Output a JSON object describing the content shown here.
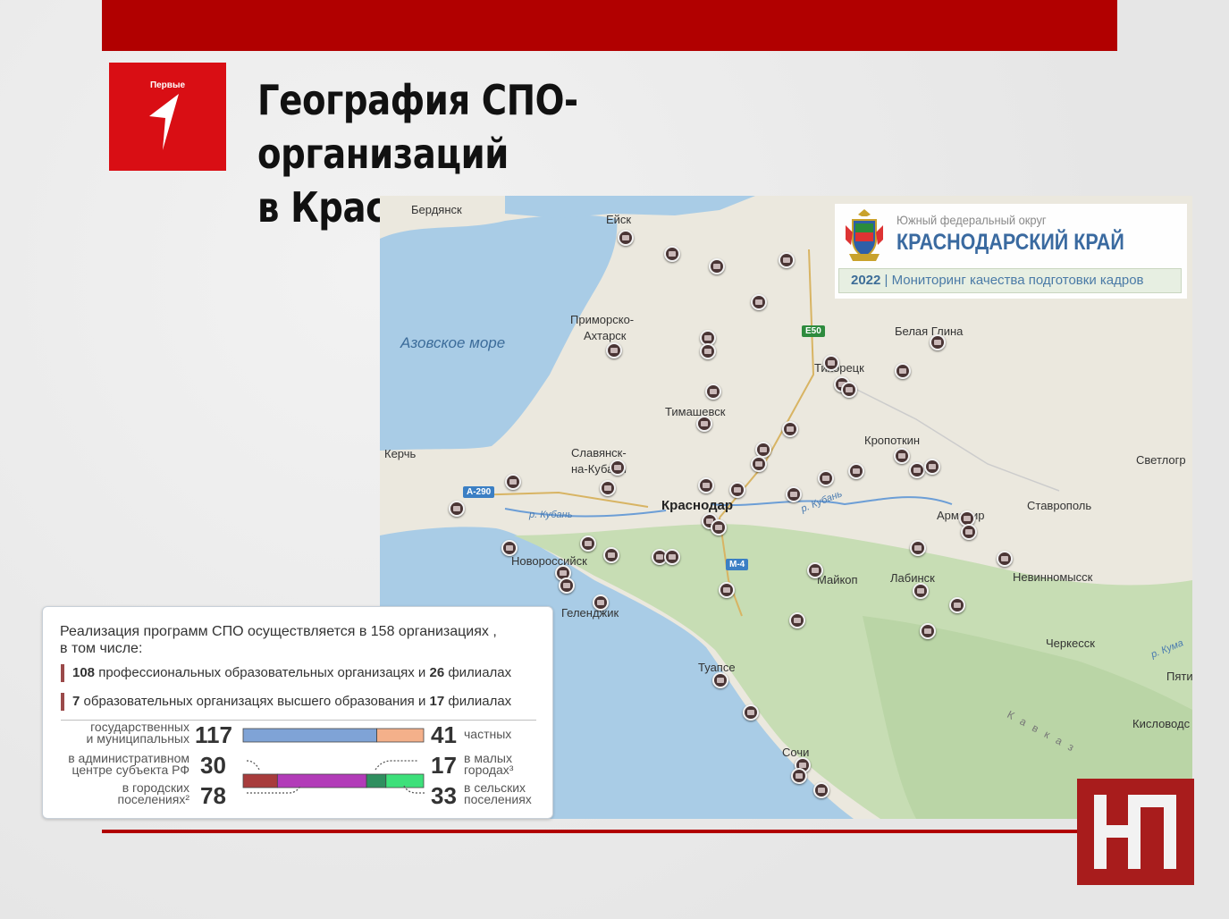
{
  "brand": {
    "logo_text": "Первые"
  },
  "title": {
    "line1": "География СПО-организаций",
    "line2": "в Краснодарском крае"
  },
  "region_box": {
    "subtitle": "Южный федеральный округ",
    "region": "КРАСНОДАРСКИЙ КРАЙ",
    "year": "2022",
    "separator": "|",
    "caption": "Мониторинг качества подготовки кадров"
  },
  "map": {
    "sea": "Азовское море",
    "cities": {
      "berdyansk": "Бердянск",
      "yeisk": "Ейск",
      "primorsko1": "Приморско-",
      "primorsko2": "Ахтарск",
      "belaya_glina": "Белая Глина",
      "tikhoretsk": "Тихорецк",
      "timashevsk": "Тимашевск",
      "kerch": "Керчь",
      "slavyansk1": "Славянск-",
      "slavyansk2": "на-Кубани",
      "kropotkin": "Кропоткин",
      "svetlograd": "Светлогр",
      "krasnodar": "Краснодар",
      "armavir": "Армавир",
      "stavropol": "Ставрополь",
      "novorossiysk": "Новороссийск",
      "maikop": "Майкоп",
      "labinsk": "Лабинск",
      "nevinnomyssk": "Невинномысск",
      "gelendzhik": "Геленджик",
      "cherkessk": "Черкесск",
      "tuapse": "Туапсе",
      "pyatigorsk": "Пяти",
      "kislovodsk": "Кисловодс",
      "sochi": "Сочи"
    },
    "rivers": {
      "kuban_w": "р. Кубань",
      "kuban_e": "р. Кубань",
      "kuma": "р. Кума"
    },
    "mountains": "Кавказ",
    "roads": {
      "e50": "E50",
      "a290": "A-290",
      "m4": "M-4"
    }
  },
  "stats": {
    "intro_line1": "Реализация программ СПО осуществляется в 158 организациях ,",
    "intro_line2": "в том числе:",
    "line1_num1": "108",
    "line1_text1": " профессиональных образовательных организацях и ",
    "line1_num2": "26",
    "line1_text2": " филиалах",
    "line2_num1": "7",
    "line2_text1": " образовательных организацях высшего образования и ",
    "line2_num2": "17",
    "line2_text2": " филиалах",
    "state_label1": "государственных",
    "state_label2": "и муниципальных",
    "state_value": "117",
    "private_value": "41",
    "private_label": "частных",
    "admin_label1": "в административном",
    "admin_label2": "центре субъекта РФ",
    "admin_value": "30",
    "small_value": "17",
    "small_label1": "в малых",
    "small_label2": "городах³",
    "urban_label1": "в городских",
    "urban_label2": "поселениях²",
    "urban_value": "78",
    "rural_value": "33",
    "rural_label1": "в сельских",
    "rural_label2": "поселениях",
    "colors": {
      "state": "#7fa3d6",
      "private": "#f4b08a",
      "admin": "#a83c3c",
      "urban": "#b23bb8",
      "small": "#2f8f5f",
      "rural": "#3de07a"
    }
  }
}
